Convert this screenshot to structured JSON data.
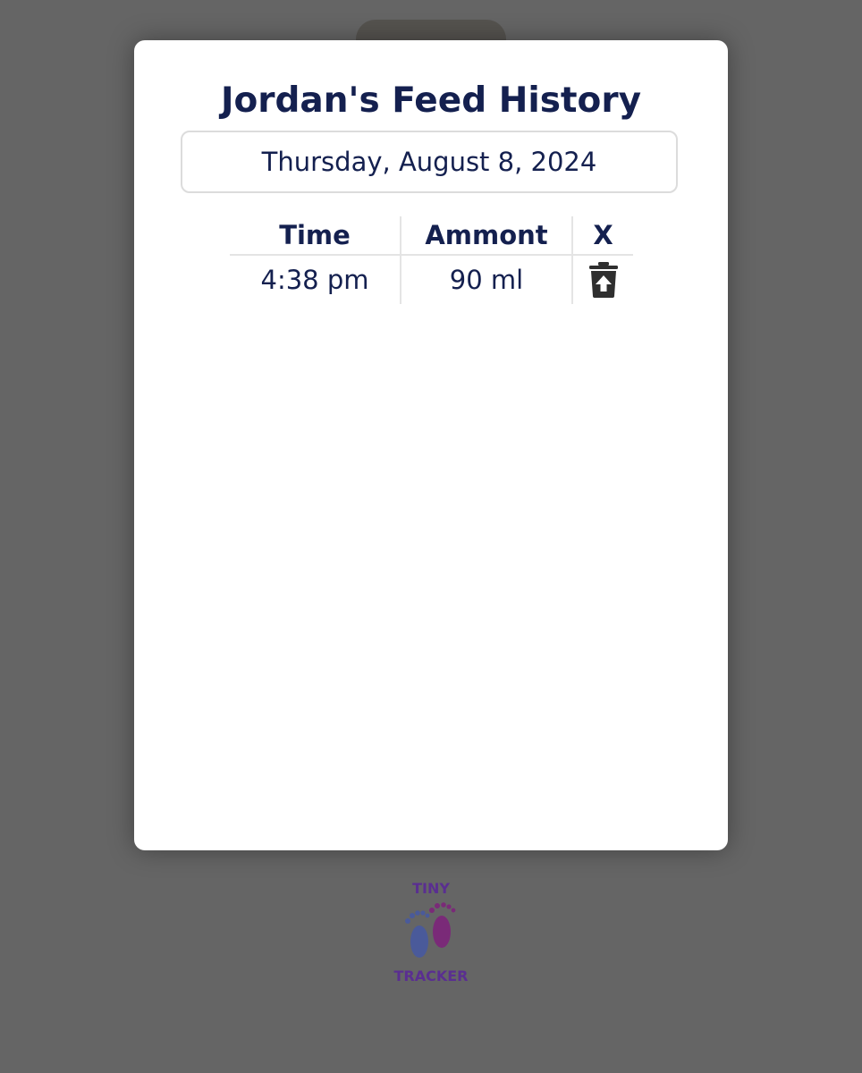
{
  "modal": {
    "title": "Jordan's Feed History",
    "date": "Thursday, August 8, 2024"
  },
  "table": {
    "headers": [
      "Time",
      "Ammont",
      "X"
    ],
    "rows": [
      {
        "time": "4:38 pm",
        "amount": "90 ml",
        "action_icon": "trash-restore-icon"
      }
    ]
  },
  "logo": {
    "top_text": "TINY",
    "bottom_text": "TRACKER",
    "icon": "baby-feet-icon"
  },
  "colors": {
    "backdrop": "#656565",
    "title_text": "#14204f",
    "logo_text": "#5a2e91",
    "foot_left": "#4a5a9a",
    "foot_right": "#7a2a78"
  }
}
